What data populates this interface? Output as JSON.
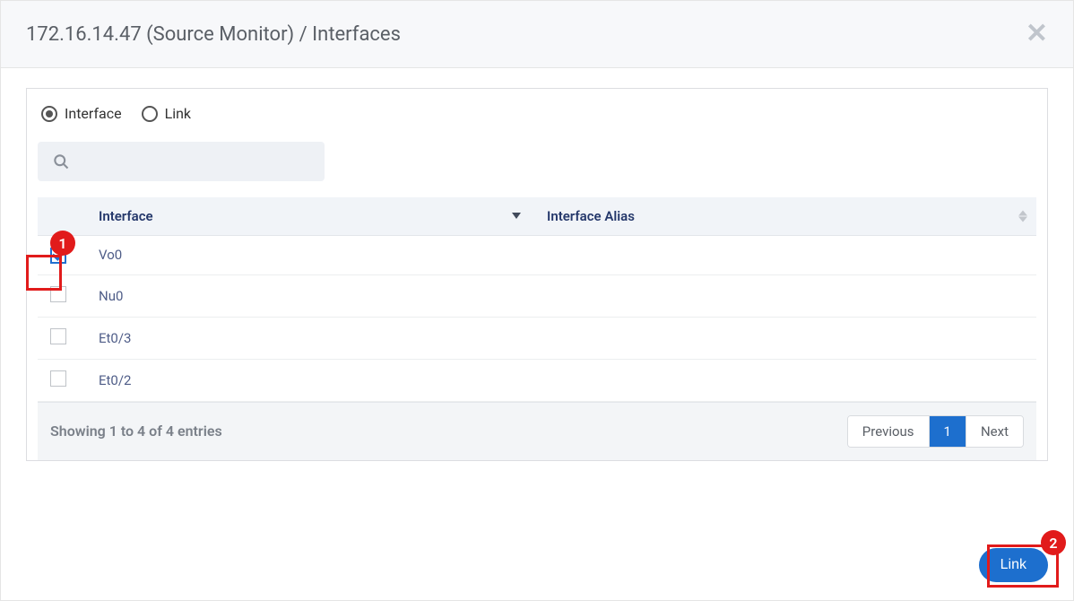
{
  "modal": {
    "title": "172.16.14.47 (Source Monitor) / Interfaces"
  },
  "radios": {
    "interface": "Interface",
    "link": "Link",
    "selected": "interface"
  },
  "table": {
    "headers": {
      "interface": "Interface",
      "alias": "Interface Alias"
    },
    "rows": [
      {
        "checked": true,
        "interface": "Vo0",
        "alias": ""
      },
      {
        "checked": false,
        "interface": "Nu0",
        "alias": ""
      },
      {
        "checked": false,
        "interface": "Et0/3",
        "alias": ""
      },
      {
        "checked": false,
        "interface": "Et0/2",
        "alias": ""
      }
    ]
  },
  "footer": {
    "entries_text": "Showing 1 to 4 of 4 entries",
    "prev": "Previous",
    "page": "1",
    "next": "Next"
  },
  "actions": {
    "link_button": "Link"
  },
  "annotations": {
    "marker1": "1",
    "marker2": "2"
  }
}
